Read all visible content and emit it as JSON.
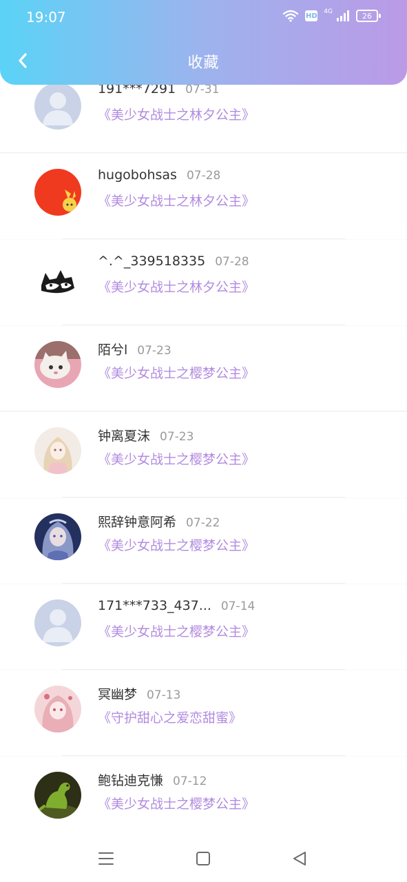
{
  "status_bar": {
    "time": "19:07",
    "network": "4G",
    "hd": "HD",
    "battery": "26"
  },
  "header": {
    "title": "收藏",
    "back_icon": "chevron-left-icon"
  },
  "favorites": [
    {
      "name": "191***7291",
      "date": "07-31",
      "work": "《美少女战士之林夕公主》",
      "avatar": "default-person"
    },
    {
      "name": "hugobohsas",
      "date": "07-28",
      "work": "《美少女战士之林夕公主》",
      "avatar": "red-cartoon"
    },
    {
      "name": "^.^_339518335",
      "date": "07-28",
      "work": "《美少女战士之林夕公主》",
      "avatar": "sketch-cats"
    },
    {
      "name": "陌兮l",
      "date": "07-23",
      "work": "《美少女战士之樱梦公主》",
      "avatar": "kitten-photo"
    },
    {
      "name": "钟离夏沫",
      "date": "07-23",
      "work": "《美少女战士之樱梦公主》",
      "avatar": "anime-girl-light"
    },
    {
      "name": "熙辞钟意阿希",
      "date": "07-22",
      "work": "《美少女战士之樱梦公主》",
      "avatar": "anime-girl-blue"
    },
    {
      "name": "171***733_437...",
      "date": "07-14",
      "work": "《美少女战士之樱梦公主》",
      "avatar": "default-person"
    },
    {
      "name": "冥幽梦",
      "date": "07-13",
      "work": "《守护甜心之爱恋甜蜜》",
      "avatar": "anime-girl-pink"
    },
    {
      "name": "鲍钻迪克慊",
      "date": "07-12",
      "work": "《美少女战士之樱梦公主》",
      "avatar": "dinosaur-toy"
    }
  ],
  "nav": {
    "menu_icon": "menu-icon",
    "home_icon": "home-square-icon",
    "back_icon": "back-triangle-icon"
  },
  "colors": {
    "header_gradient_start": "#5ad3f6",
    "header_gradient_end": "#bb9ae6",
    "work_title": "#b28be0",
    "date_text": "#9a9a9a"
  }
}
